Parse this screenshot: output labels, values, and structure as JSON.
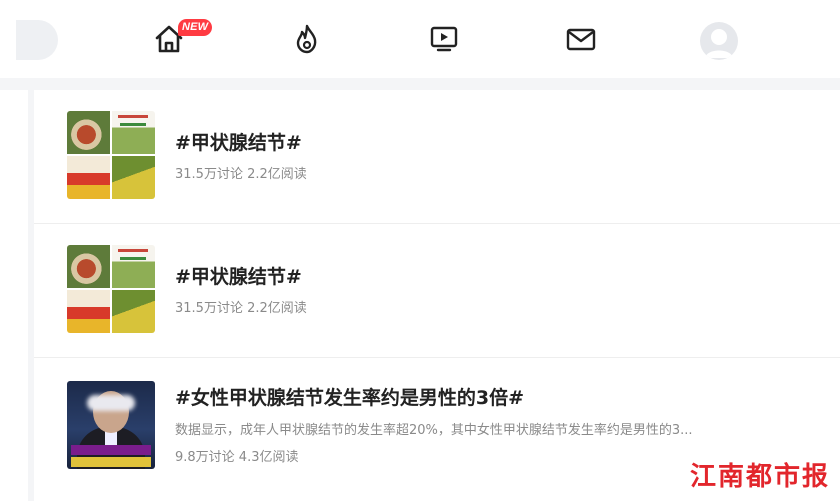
{
  "nav": {
    "new_badge": "NEW",
    "icons": [
      "home-icon",
      "fire-icon",
      "video-play-icon",
      "mail-icon",
      "avatar"
    ]
  },
  "topics": [
    {
      "title": "#甲状腺结节#",
      "meta": "31.5万讨论 2.2亿阅读",
      "thumb": "image-grid"
    },
    {
      "title": "#甲状腺结节#",
      "meta": "31.5万讨论 2.2亿阅读",
      "thumb": "image-grid"
    },
    {
      "title": "#女性甲状腺结节发生率约是男性的3倍#",
      "description": "数据显示，成年人甲状腺结节的发生率超20%，其中女性甲状腺结节发生率约是男性的3...",
      "meta": "9.8万讨论 4.3亿阅读",
      "thumb": "video-still"
    }
  ],
  "watermark": "江南都市报",
  "colors": {
    "accent_red": "#ff3b42",
    "title_text": "#222222",
    "meta_text": "#8a8a8a",
    "band_gray": "#f4f5f7"
  }
}
